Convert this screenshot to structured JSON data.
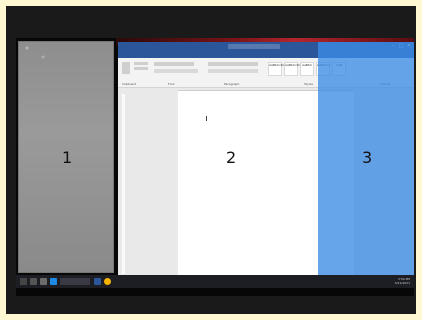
{
  "zones": [
    {
      "label": "1"
    },
    {
      "label": "2"
    },
    {
      "label": "3"
    }
  ],
  "word": {
    "tabs": [
      "File",
      "Home",
      "Insert",
      "Design",
      "Layout",
      "References",
      "Mailings",
      "Review",
      "View",
      "Help",
      "ACROBAT"
    ],
    "styles": [
      "AaBbCcDd",
      "AaBbCcDd",
      "AaBbC",
      "AaBbCcC",
      "AaB"
    ],
    "ribbon_groups": [
      "Clipboard",
      "Font",
      "Paragraph",
      "Styles",
      "Editing"
    ],
    "status_left": [
      "Page 1 of 1",
      "0 words",
      "English"
    ],
    "titlebar_controls": [
      "–",
      "□",
      "✕"
    ]
  },
  "taskbar": {
    "tray_time": "3:59 PM",
    "tray_date": "3/21/2021"
  },
  "colors": {
    "zone3_overlay": "#3c8ce6",
    "word_blue": "#2b579a",
    "taskbar": "#1d1d24"
  }
}
